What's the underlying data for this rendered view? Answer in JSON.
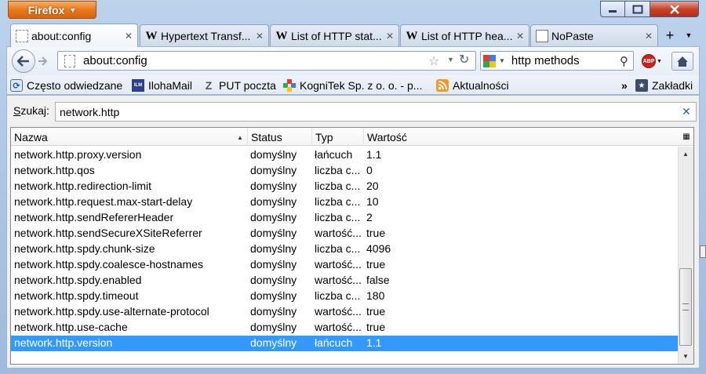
{
  "window": {
    "app_button": "Firefox"
  },
  "tabs": [
    {
      "label": "about:config",
      "icon": "blank-page-icon",
      "active": true
    },
    {
      "label": "Hypertext Transf...",
      "icon": "wikipedia-icon"
    },
    {
      "label": "List of HTTP stat...",
      "icon": "wikipedia-icon"
    },
    {
      "label": "List of HTTP hea...",
      "icon": "wikipedia-icon"
    },
    {
      "label": "NoPaste",
      "icon": "nopaste-icon"
    }
  ],
  "wiki_glyph": "W",
  "nav": {
    "url": "about:config",
    "search_query": "http methods",
    "abp_label": "ABP"
  },
  "bookmarks": [
    {
      "label": "Często odwiedzane",
      "icon": "most-visited-icon"
    },
    {
      "label": "IlohaMail",
      "icon": "ilohamail-icon",
      "icon_text": "ILM"
    },
    {
      "label": "PUT poczta",
      "icon": "put-icon",
      "icon_text": "Z"
    },
    {
      "label": "KogniTek Sp. z o. o. - p...",
      "icon": "kognitek-icon"
    },
    {
      "label": "Aktualności",
      "icon": "rss-icon"
    }
  ],
  "bookmarks_overflow": "»",
  "bookmarks_menu": "Zakładki",
  "filter": {
    "label_prefix": "S",
    "label_rest": "zukaj:",
    "value": "network.http"
  },
  "table": {
    "columns": [
      "Nazwa",
      "Status",
      "Typ",
      "Wartość"
    ],
    "sort_column": "Nazwa",
    "rows": [
      {
        "name": "network.http.proxy.version",
        "status": "domyślny",
        "type": "łańcuch",
        "value": "1.1"
      },
      {
        "name": "network.http.qos",
        "status": "domyślny",
        "type": "liczba c...",
        "value": "0"
      },
      {
        "name": "network.http.redirection-limit",
        "status": "domyślny",
        "type": "liczba c...",
        "value": "20"
      },
      {
        "name": "network.http.request.max-start-delay",
        "status": "domyślny",
        "type": "liczba c...",
        "value": "10"
      },
      {
        "name": "network.http.sendRefererHeader",
        "status": "domyślny",
        "type": "liczba c...",
        "value": "2"
      },
      {
        "name": "network.http.sendSecureXSiteReferrer",
        "status": "domyślny",
        "type": "wartość...",
        "value": "true"
      },
      {
        "name": "network.http.spdy.chunk-size",
        "status": "domyślny",
        "type": "liczba c...",
        "value": "4096"
      },
      {
        "name": "network.http.spdy.coalesce-hostnames",
        "status": "domyślny",
        "type": "wartość...",
        "value": "true"
      },
      {
        "name": "network.http.spdy.enabled",
        "status": "domyślny",
        "type": "wartość...",
        "value": "false"
      },
      {
        "name": "network.http.spdy.timeout",
        "status": "domyślny",
        "type": "liczba c...",
        "value": "180"
      },
      {
        "name": "network.http.spdy.use-alternate-protocol",
        "status": "domyślny",
        "type": "wartość...",
        "value": "true"
      },
      {
        "name": "network.http.use-cache",
        "status": "domyślny",
        "type": "wartość...",
        "value": "true"
      },
      {
        "name": "network.http.version",
        "status": "domyślny",
        "type": "łańcuch",
        "value": "1.1",
        "selected": true
      }
    ]
  },
  "colors": {
    "selection": "#3399ff",
    "firefox_orange": "#e8781d",
    "close_red": "#c7432a"
  }
}
